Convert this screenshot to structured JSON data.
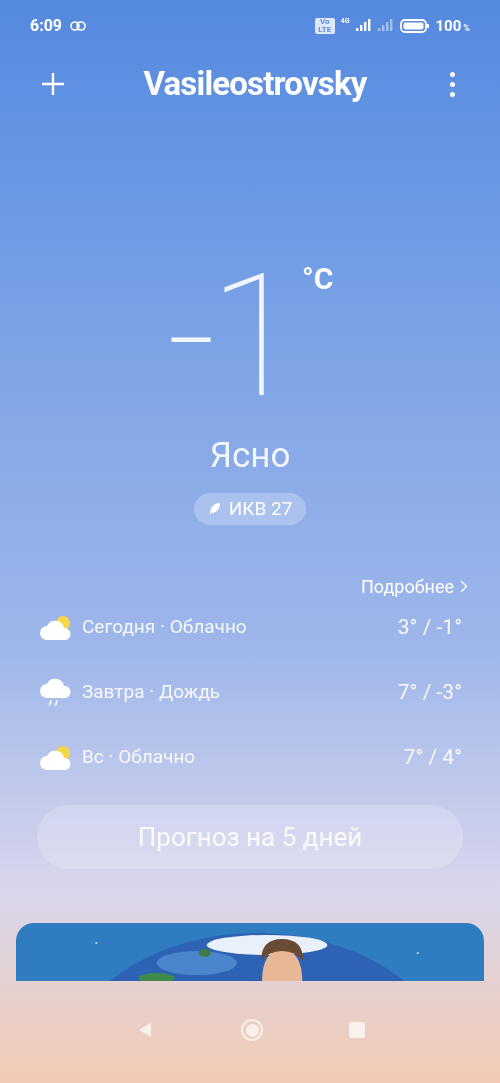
{
  "status_bar": {
    "time": "6:09",
    "volte": "Vo LTE",
    "network": "4G",
    "battery": "100",
    "battery_unit": "%"
  },
  "header": {
    "title": "Vasileostrovsky"
  },
  "current": {
    "temperature": "-1",
    "unit": "°C",
    "condition": "Ясно",
    "aqi": "ИКВ 27"
  },
  "forecast": {
    "more_link": "Подробнее",
    "days": [
      {
        "kind": "cloudy",
        "label": "Сегодня · Облачно",
        "temps": "3° / -1°"
      },
      {
        "kind": "rain",
        "label": "Завтра · Дождь",
        "temps": "7° / -3°"
      },
      {
        "kind": "cloudy",
        "label": "Вс · Облачно",
        "temps": "7° / 4°"
      }
    ],
    "button": "Прогноз на 5 дней"
  }
}
